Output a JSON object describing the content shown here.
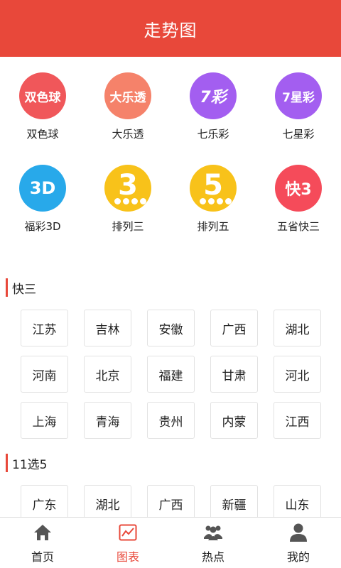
{
  "header": {
    "title": "走势图"
  },
  "lotteries": [
    {
      "label": "双色球",
      "icon": "ssq-logo-icon",
      "icon_text": "双色球",
      "color": "#f0575a"
    },
    {
      "label": "大乐透",
      "icon": "dlt-logo-icon",
      "icon_text": "大乐透",
      "color": "#f5826a"
    },
    {
      "label": "七乐彩",
      "icon": "qlc-logo-icon",
      "icon_text": "7彩",
      "color": "#a35ef0"
    },
    {
      "label": "七星彩",
      "icon": "qxc-logo-icon",
      "icon_text": "7星彩",
      "color": "#a35ef0"
    },
    {
      "label": "福彩3D",
      "icon": "fc3d-logo-icon",
      "icon_text": "3D",
      "color": "#28a9ea"
    },
    {
      "label": "排列三",
      "icon": "pl3-logo-icon",
      "icon_text": "3",
      "color": "#f8c21a"
    },
    {
      "label": "排列五",
      "icon": "pl5-logo-icon",
      "icon_text": "5",
      "color": "#f8c21a"
    },
    {
      "label": "五省快三",
      "icon": "wsk3-logo-icon",
      "icon_text": "快3",
      "color": "#f54b5a"
    }
  ],
  "sections": [
    {
      "title": "快三",
      "regions": [
        "江苏",
        "吉林",
        "安徽",
        "广西",
        "湖北",
        "河南",
        "北京",
        "福建",
        "甘肃",
        "河北",
        "上海",
        "青海",
        "贵州",
        "内蒙",
        "江西"
      ]
    },
    {
      "title": "11选5",
      "regions": [
        "广东",
        "湖北",
        "广西",
        "新疆",
        "山东"
      ]
    }
  ],
  "tabs": [
    {
      "label": "首页",
      "icon": "home-icon",
      "active": false
    },
    {
      "label": "图表",
      "icon": "chart-icon",
      "active": true
    },
    {
      "label": "热点",
      "icon": "people-icon",
      "active": false
    },
    {
      "label": "我的",
      "icon": "user-icon",
      "active": false
    }
  ],
  "colors": {
    "accent": "#e8483a",
    "text": "#222222",
    "border": "#e2e2e2",
    "icon_gray": "#555555"
  }
}
